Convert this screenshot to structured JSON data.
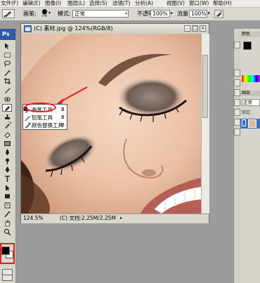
{
  "menu": {
    "items": [
      "文件(F)",
      "编辑(E)",
      "图像(I)",
      "图层(L)",
      "选择(S)",
      "滤镜(T)",
      "分析(A)",
      "视图(V)",
      "窗口(W)",
      "帮助(H)"
    ]
  },
  "options_bar": {
    "brush_label": "画笔:",
    "brush_size": "79",
    "mode_label": "模式:",
    "mode_value": "正常",
    "opacity_label": "不透明度:",
    "opacity_value": "100%",
    "flow_label": "流量:",
    "flow_value": "100%"
  },
  "tools_panel": {
    "header": "Ps"
  },
  "document": {
    "title": "(C) 素材.jpg @ 124%(RGB/8)",
    "zoom": "124.5%",
    "doc_info": "(C) 文档:2.25M/2.25M"
  },
  "tool_flyout": {
    "items": [
      {
        "label": "画笔工具",
        "key": "B",
        "selected": true
      },
      {
        "label": "铅笔工具",
        "key": "B",
        "selected": false
      },
      {
        "label": "颜色替换工具",
        "key": "B",
        "selected": false
      }
    ]
  },
  "right_panels": {
    "top_tab": "颜色",
    "mid_tab": "图层",
    "blend_mode": "正常",
    "lock_label": "锁定:"
  },
  "colors": {
    "annotation_red": "#e51c1c",
    "foreground": "#000000",
    "background": "#ffffff",
    "ps_blue": "#2f5aa8"
  }
}
